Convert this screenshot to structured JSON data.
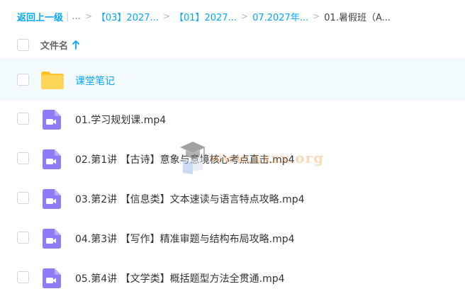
{
  "breadcrumb": {
    "back_label": "返回上一级",
    "separator_bar": "|",
    "ellipsis": "...",
    "sep": ">",
    "items": [
      {
        "label": "【03】2027..."
      },
      {
        "label": "【01】2027..."
      },
      {
        "label": "07.2027年..."
      }
    ],
    "current": "01.暑假班（A..."
  },
  "list_header": {
    "column_name": "文件名"
  },
  "files": [
    {
      "name": "课堂笔记",
      "type": "folder",
      "icon": "folder-icon"
    },
    {
      "name": "01.学习规划课.mp4",
      "type": "video",
      "icon": "video-file-icon"
    },
    {
      "name": "02.第1讲 【古诗】意象与意境核心考点直击.mp4",
      "type": "video",
      "icon": "video-file-icon"
    },
    {
      "name": "03.第2讲 【信息类】文本速读与语言特点攻略.mp4",
      "type": "video",
      "icon": "video-file-icon"
    },
    {
      "name": "04.第3讲 【写作】精准审题与结构布局攻略.mp4",
      "type": "video",
      "icon": "video-file-icon"
    },
    {
      "name": "05.第4讲 【文学类】概括题型方法全贯通.mp4",
      "type": "video",
      "icon": "video-file-icon"
    }
  ],
  "watermark": {
    "text": "www.xxxx.org",
    "icon": "graduation-cap-icon"
  },
  "colors": {
    "accent": "#06a7ff",
    "folder": "#ffd04b",
    "video": "#8e7cf6",
    "row_highlight": "#f3fbfe"
  }
}
